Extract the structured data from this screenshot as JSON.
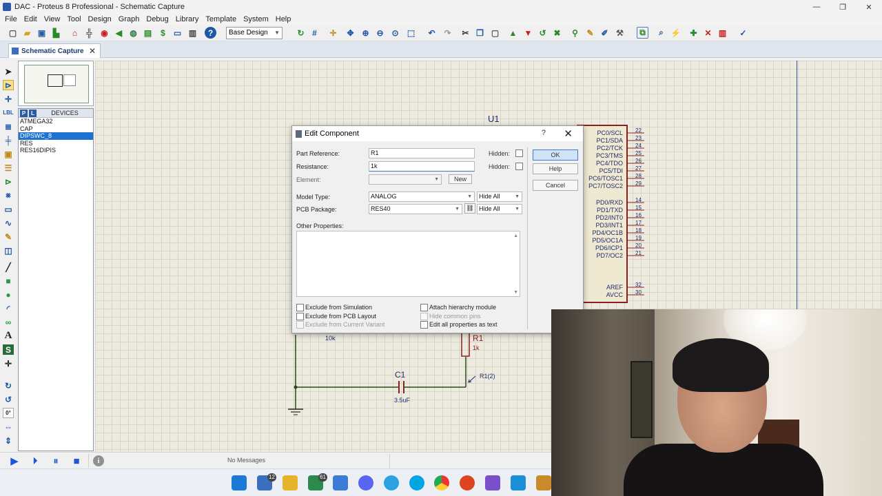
{
  "window": {
    "title": "DAC - Proteus 8 Professional - Schematic Capture",
    "min_icon": "minimize-icon",
    "max_icon": "maximize-icon",
    "close_glyph": "✕"
  },
  "menu": [
    "File",
    "Edit",
    "View",
    "Tool",
    "Design",
    "Graph",
    "Debug",
    "Library",
    "Template",
    "System",
    "Help"
  ],
  "toolbar": {
    "design_select": "Base Design"
  },
  "tab": {
    "label": "Schematic Capture",
    "close": "✕"
  },
  "devices": {
    "p_label": "P",
    "l_label": "L",
    "title": "DEVICES",
    "items": [
      "ATMEGA32",
      "CAP",
      "DIPSWC_8",
      "RES",
      "RES16DIPIS"
    ],
    "selected_index": 2
  },
  "schematic": {
    "u1_ref": "U1",
    "pins_c": [
      {
        "name": "PC0/SCL",
        "num": "22"
      },
      {
        "name": "PC1/SDA",
        "num": "23"
      },
      {
        "name": "PC2/TCK",
        "num": "24"
      },
      {
        "name": "PC3/TMS",
        "num": "25"
      },
      {
        "name": "PC4/TDO",
        "num": "26"
      },
      {
        "name": "PC5/TDI",
        "num": "27"
      },
      {
        "name": "PC6/TOSC1",
        "num": "28"
      },
      {
        "name": "PC7/TOSC2",
        "num": "29"
      }
    ],
    "pins_d": [
      {
        "name": "PD0/RXD",
        "num": "14"
      },
      {
        "name": "PD1/TXD",
        "num": "15"
      },
      {
        "name": "PD2/INT0",
        "num": "16"
      },
      {
        "name": "PD3/INT1",
        "num": "17"
      },
      {
        "name": "PD4/OC1B",
        "num": "18"
      },
      {
        "name": "PD5/OC1A",
        "num": "19"
      },
      {
        "name": "PD6/ICP1",
        "num": "20"
      },
      {
        "name": "PD7/OC2",
        "num": "21"
      }
    ],
    "pins_power": [
      {
        "name": "AREF",
        "num": "32"
      },
      {
        "name": "AVCC",
        "num": "30"
      }
    ],
    "r_value_left": "10k",
    "r1_ref": "R1",
    "r1_value": "1k",
    "c1_ref": "C1",
    "c1_value": "3.5uF",
    "probe_label": "R1(2)"
  },
  "dialog": {
    "title": "Edit Component",
    "help_glyph": "?",
    "close_glyph": "✕",
    "part_reference_label": "Part Reference:",
    "part_reference_value": "R1",
    "resistance_label": "Resistance:",
    "resistance_value": "1k",
    "hidden_label": "Hidden:",
    "element_label": "Element:",
    "new_button": "New",
    "model_type_label": "Model Type:",
    "model_type_value": "ANALOG",
    "pcb_package_label": "PCB Package:",
    "pcb_package_value": "RES40",
    "hide_all_1": "Hide All",
    "hide_all_2": "Hide All",
    "other_properties_label": "Other Properties:",
    "ok_button": "OK",
    "help_button": "Help",
    "cancel_button": "Cancel",
    "exclude_sim": "Exclude from Simulation",
    "exclude_pcb": "Exclude from PCB Layout",
    "exclude_variant": "Exclude from Current Variant",
    "attach_hierarchy": "Attach hierarchy module",
    "hide_common_pins": "Hide common pins",
    "edit_all_text": "Edit all properties as text"
  },
  "status": {
    "message": "No Messages"
  },
  "taskbar": {
    "badge_1": "12",
    "badge_2": "61"
  }
}
